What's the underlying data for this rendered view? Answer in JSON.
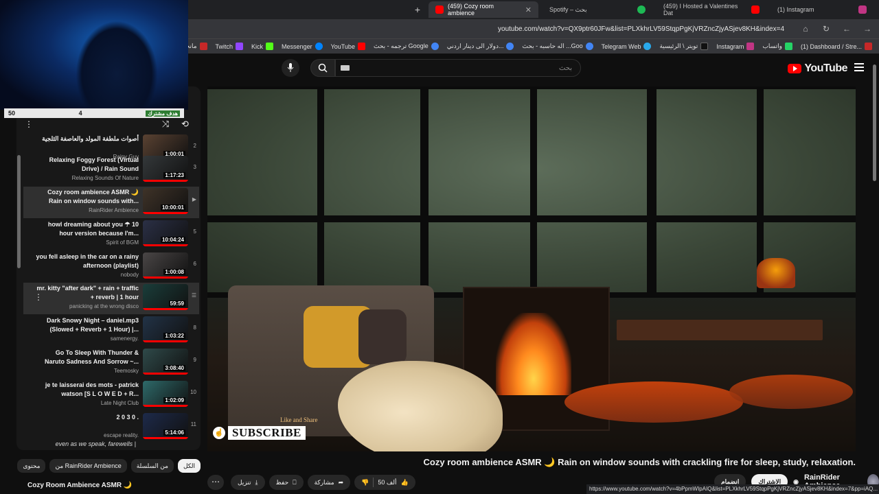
{
  "browser": {
    "tabs": [
      {
        "label": "(459) Cozy room ambience",
        "active": true,
        "icon": "youtube-icon"
      },
      {
        "label": "Spotify – بحث",
        "active": false,
        "icon": "spotify-icon"
      },
      {
        "label": "(459) I Hosted a Valentines Dat",
        "active": false,
        "icon": "youtube-icon"
      },
      {
        "label": "(1) Instagram",
        "active": false,
        "icon": "instagram-icon"
      }
    ],
    "url": "youtube.com/watch?v=QX9ptr60JFw&list=PLXkhrLV59StqpPgKjVRZncZjyASjev8KH&index=4",
    "bookmarks": [
      "مانجا العاشق",
      "Twitch",
      "Kick",
      "Messenger",
      "YouTube",
      "ترجمه - بحث Google",
      "دولار الى دينار اردني...",
      "اله حاسبه - بحث ...Goo",
      "Telegram Web",
      "تويتر \\ الرئيسية",
      "Instagram",
      "واتساب",
      "(1) Dashboard / Stre..."
    ],
    "status_url": "https://www.youtube.com/watch?v=4bPpmWIpAIQ&list=PLXkhrLV59StqpPgKjVRZncZjyASjev8KH&index=7&pp=iAQ..."
  },
  "webcam": {
    "bar_left": "50",
    "bar_mid": "4",
    "bar_right": "هدف مشترك"
  },
  "search": {
    "placeholder": "بحث"
  },
  "youtube_logo": "YouTube",
  "video": {
    "subscribe_text": "SUBSCRIBE",
    "like_share": "Like and Share",
    "title": "Cozy room ambience ASMR 🌙 Rain on window sounds with crackling fire for sleep, study, relaxation."
  },
  "channel": {
    "name": "RainRider Ambience",
    "subscribe_label": "الاشتراك",
    "join_label": "انضمام"
  },
  "actions": {
    "like_count": "50 ألف",
    "share": "مشاركة",
    "save": "حفظ",
    "download": "تنزيل"
  },
  "playlist": {
    "items": [
      {
        "num": "2",
        "title": "أصوات ملطفة المولد والعاصفة الثلجية",
        "channel": "Rainy Guy",
        "duration": "1:00:01",
        "thumb": "#5a4232"
      },
      {
        "num": "3",
        "title": "Relaxing Foggy Forest (Virtual Drive) / Rain Sound",
        "channel": "Relaxing Sounds Of Nature",
        "duration": "1:17:23",
        "thumb": "#34383a"
      },
      {
        "num": "",
        "title": "Cozy room ambience ASMR 🌙 Rain on window sounds with...",
        "channel": "RainRider Ambience",
        "duration": "10:00:01",
        "thumb": "#3f3328",
        "active": true
      },
      {
        "num": "5",
        "title": "howl dreaming about you ☂ 10 hour version because I'm...",
        "channel": "Spirit of BGM",
        "duration": "10:04:24",
        "thumb": "#2b3046"
      },
      {
        "num": "6",
        "title": "you fell asleep in the car on a rainy afternoon (playlist)",
        "channel": "nobody",
        "duration": "1:00:08",
        "thumb": "#4a4646"
      },
      {
        "num": "",
        "title": "mr. kitty \"after dark\" + rain + traffic + reverb | 1 hour",
        "channel": "panicking at the wrong disco",
        "duration": "59:59",
        "thumb": "#1a3d3a",
        "hover": true
      },
      {
        "num": "8",
        "title": "Dark Snowy Night – daniel.mp3 (Slowed + Reverb + 1 Hour) |...",
        "channel": "samenergy.",
        "duration": "1:03:22",
        "thumb": "#223347"
      },
      {
        "num": "9",
        "title": "Go To Sleep With Thunder & Naruto Sadness And Sorrow ~...",
        "channel": "Teemosky",
        "duration": "3:08:40",
        "thumb": "#2f4a4a"
      },
      {
        "num": "10",
        "title": "je te laisserai des mots - patrick watson [S L O W E D + R...",
        "channel": "Late Night Club",
        "duration": "1:02:09",
        "thumb": "#2e6a6a"
      },
      {
        "num": "11",
        "title": "2 0 3 0 .",
        "channel": "escape reality.",
        "duration": "5:14:06",
        "thumb": "#1d2a4a"
      }
    ],
    "footer_text": "even as we speak, farewells |"
  },
  "chips": [
    "الكل",
    "من السلسلة",
    "من RainRider Ambience",
    "محتوى"
  ],
  "next_up": "Cozy Room Ambience ASMR 🌙"
}
